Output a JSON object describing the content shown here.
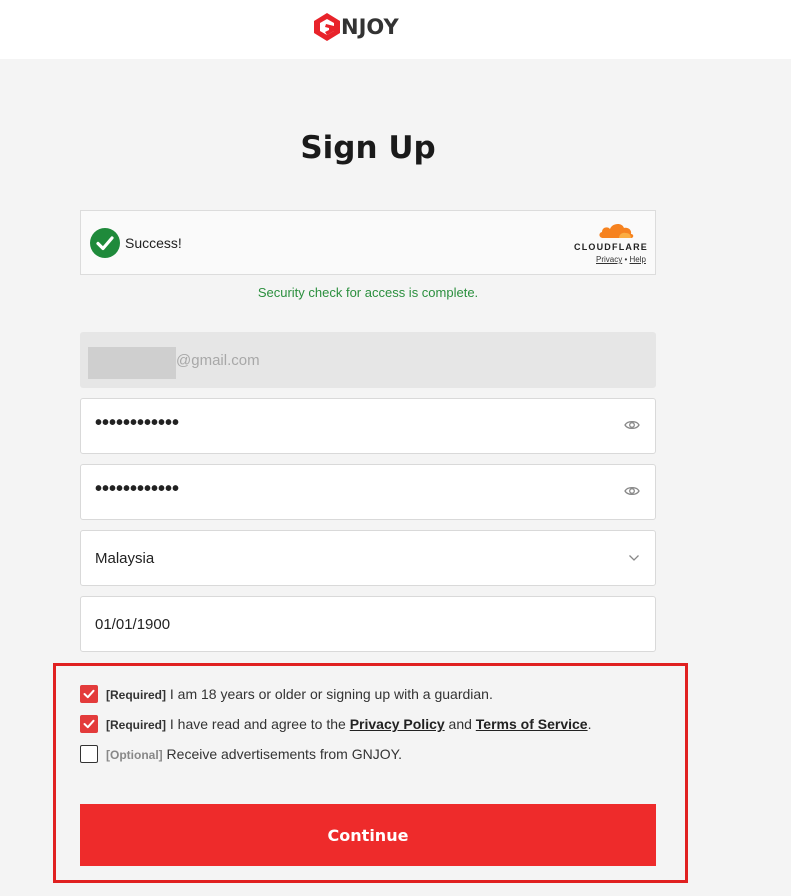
{
  "header": {
    "logo_text": "NJOY",
    "brand_color": "#e8232a"
  },
  "page": {
    "title": "Sign Up"
  },
  "captcha": {
    "status": "Success!",
    "provider": "CLOUDFLARE",
    "privacy_label": "Privacy",
    "separator": "•",
    "help_label": "Help",
    "note": "Security check for access is complete."
  },
  "form": {
    "email_suffix": "@gmail.com",
    "password_mask": "••••••••••••",
    "confirm_password_mask": "••••••••••••",
    "country": "Malaysia",
    "birthdate": "01/01/1900"
  },
  "consents": [
    {
      "tag": "[Required]",
      "text": "I am 18 years or older or signing up with a guardian.",
      "checked": true
    },
    {
      "tag": "[Required]",
      "text_before": "I have read and agree to the",
      "link1": "Privacy Policy",
      "text_mid": "and",
      "link2": "Terms of Service",
      "text_after": ".",
      "checked": true
    },
    {
      "tag": "[Optional]",
      "text": "Receive advertisements from GNJOY.",
      "checked": false
    }
  ],
  "continue_label": "Continue",
  "colors": {
    "accent": "#ee2b2b",
    "success": "#2b8f3e",
    "highlight_border": "#e02020"
  }
}
